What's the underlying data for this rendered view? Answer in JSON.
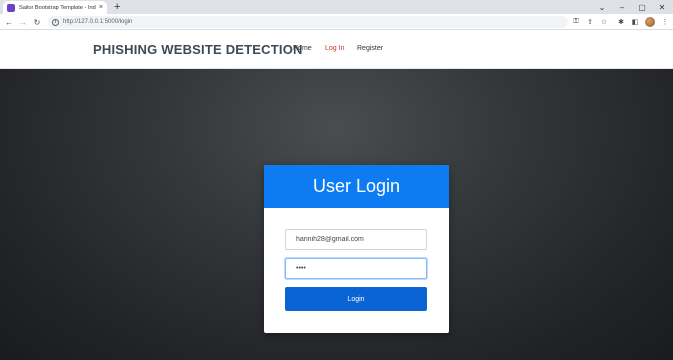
{
  "browser": {
    "tab_title": "Sailor Bootstrap Template - Index",
    "url": "http://127.0.0.1:5000/login",
    "new_tab": "+",
    "close_tab": "×"
  },
  "site": {
    "brand": "PHISHING WEBSITE DETECTION",
    "nav": [
      "Home",
      "Log In",
      "Register"
    ],
    "active_nav": "Log In"
  },
  "login": {
    "title": "User Login",
    "email_value": "harinih28@gmail.com",
    "password_value": "••••",
    "button_label": "Login"
  },
  "colors": {
    "accent": "#0d7cf2",
    "button": "#0a64d3",
    "active_link": "#c0392b"
  }
}
